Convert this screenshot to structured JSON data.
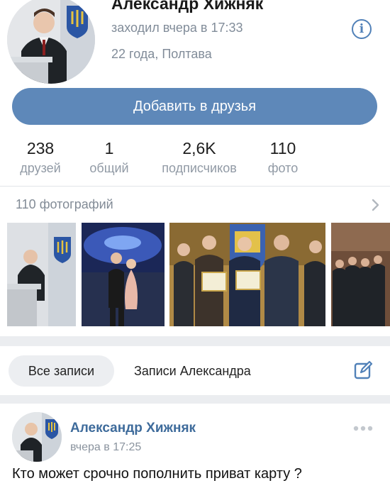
{
  "profile": {
    "name": "Александр Хижняк",
    "status": "заходил вчера в 17:33",
    "details": "22 года, Полтава"
  },
  "actions": {
    "add_friend": "Добавить в друзья"
  },
  "counters": [
    {
      "value": "238",
      "label": "друзей"
    },
    {
      "value": "1",
      "label": "общий"
    },
    {
      "value": "2,6K",
      "label": "подписчиков"
    },
    {
      "value": "110",
      "label": "фото"
    }
  ],
  "photos": {
    "title": "110 фотографий"
  },
  "tabs": {
    "all_posts": "Все записи",
    "user_posts": "Записи Александра"
  },
  "post": {
    "author": "Александр Хижняк",
    "time": "вчера в 17:25",
    "text": "Кто может срочно пополнить приват карту ?"
  },
  "icons": [
    "info-icon",
    "chevron-right-icon",
    "edit-icon",
    "more-dots-icon"
  ],
  "colors": {
    "accent": "#5e88b9",
    "link": "#3e6b9b",
    "muted": "#818c99"
  }
}
